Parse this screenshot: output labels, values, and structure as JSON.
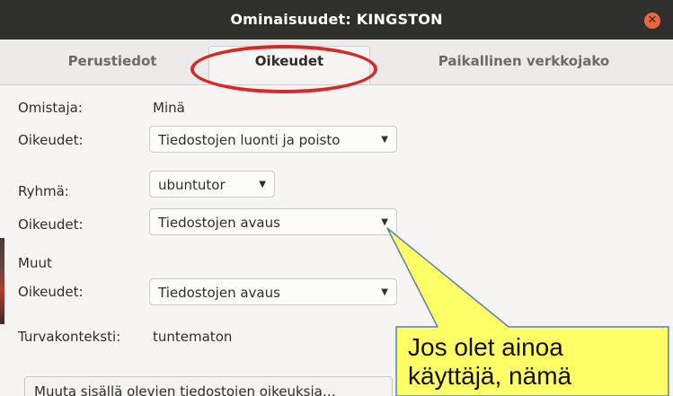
{
  "window": {
    "title": "Ominaisuudet: KINGSTON",
    "close_icon": "close-icon"
  },
  "tabs": [
    {
      "label": "Perustiedot",
      "active": false
    },
    {
      "label": "Oikeudet",
      "active": true
    },
    {
      "label": "Paikallinen verkkojako",
      "active": false
    }
  ],
  "owner": {
    "label": "Omistaja:",
    "value": "Minä",
    "access_label": "Oikeudet:",
    "access_value": "Tiedostojen luonti ja poisto"
  },
  "group": {
    "label": "Ryhmä:",
    "value": "ubuntutor",
    "access_label": "Oikeudet:",
    "access_value": "Tiedostojen avaus"
  },
  "others": {
    "heading": "Muut",
    "access_label": "Oikeudet:",
    "access_value": "Tiedostojen avaus"
  },
  "security": {
    "label": "Turvakonteksti:",
    "value": "tuntematon"
  },
  "change_button": {
    "label": "Muuta sisällä olevien tiedostojen oikeuksia…"
  },
  "annotation": {
    "callout_line1": "Jos olet ainoa",
    "callout_line2": "käyttäjä, nämä",
    "callout_fill": "#ffff66",
    "highlight_color": "#d42a2a"
  },
  "colors": {
    "titlebar": "#2f2f2d",
    "close": "#e9683e",
    "content_bg": "#f6f5f4"
  }
}
